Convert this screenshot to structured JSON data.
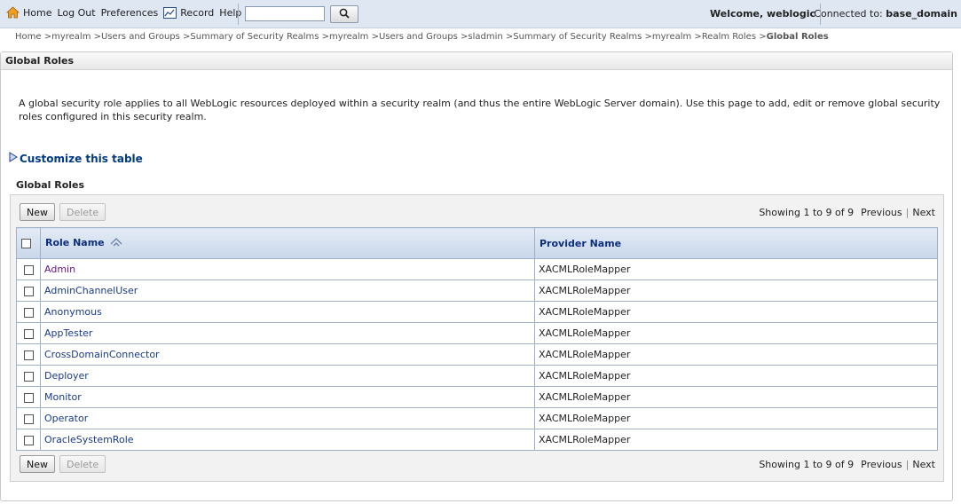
{
  "topbar": {
    "nav": {
      "home": "Home",
      "logout": "Log Out",
      "preferences": "Preferences",
      "record": "Record",
      "help": "Help"
    },
    "search": {
      "value": "",
      "placeholder": ""
    },
    "welcome": "Welcome, weblogic",
    "connected_label": "Connected to:",
    "connected_domain": "base_domain"
  },
  "breadcrumb": [
    "Home",
    "myrealm",
    "Users and Groups",
    "Summary of Security Realms",
    "myrealm",
    "Users and Groups",
    "sladmin",
    "Summary of Security Realms",
    "myrealm",
    "Realm Roles"
  ],
  "breadcrumb_sep": " >",
  "breadcrumb_current": "Global Roles",
  "page": {
    "title": "Global Roles",
    "description": "A global security role applies to all WebLogic resources deployed within a security realm (and thus the entire WebLogic Server domain). Use this page to add, edit or remove global security roles configured in this security realm.",
    "customize_link": "Customize this table",
    "section_title": "Global Roles"
  },
  "table": {
    "new_label": "New",
    "delete_label": "Delete",
    "showing": "Showing 1 to 9 of 9",
    "previous": "Previous",
    "next": "Next",
    "columns": {
      "role_name": "Role Name",
      "provider_name": "Provider Name"
    },
    "rows": [
      {
        "role": "Admin",
        "provider": "XACMLRoleMapper"
      },
      {
        "role": "AdminChannelUser",
        "provider": "XACMLRoleMapper"
      },
      {
        "role": "Anonymous",
        "provider": "XACMLRoleMapper"
      },
      {
        "role": "AppTester",
        "provider": "XACMLRoleMapper"
      },
      {
        "role": "CrossDomainConnector",
        "provider": "XACMLRoleMapper"
      },
      {
        "role": "Deployer",
        "provider": "XACMLRoleMapper"
      },
      {
        "role": "Monitor",
        "provider": "XACMLRoleMapper"
      },
      {
        "role": "Operator",
        "provider": "XACMLRoleMapper"
      },
      {
        "role": "OracleSystemRole",
        "provider": "XACMLRoleMapper"
      }
    ]
  },
  "icons": {
    "home": "home-icon",
    "record": "record-icon",
    "search": "magnifier-icon",
    "customize": "triangle-right-icon",
    "sort": "sort-ascending-icon"
  },
  "colors": {
    "link": "#1a3a8f",
    "visited_link": "#6a1b8a",
    "header_text": "#0d2e7a",
    "topbar_bg": "#dfe7f3"
  }
}
